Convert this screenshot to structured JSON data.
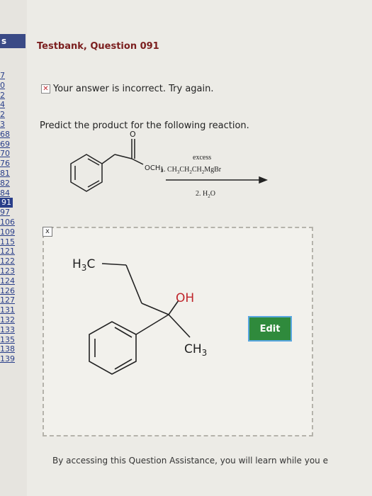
{
  "sidebar": {
    "top_tab": "s",
    "items": [
      "7",
      "0",
      "2",
      "4",
      "2",
      "3",
      "68",
      "69",
      "70",
      "76",
      "81",
      "82",
      "84",
      "91",
      "97",
      "106",
      "109",
      "115",
      "121",
      "122",
      "123",
      "124",
      "126",
      "127",
      "131",
      "132",
      "133",
      "135",
      "138",
      "139"
    ],
    "current": "91"
  },
  "title": "Testbank, Question 091",
  "feedback": {
    "icon": "x-icon",
    "text": "Your answer is incorrect.  Try again."
  },
  "prompt": "Predict the product for the following reaction.",
  "reaction": {
    "carbonyl_o": "O",
    "ester_group": "OCH",
    "ester_sub": "3",
    "reagent_excess": "excess",
    "reagent_1": "1. CH",
    "reagent_1_sub1": "3",
    "reagent_1_mid1": "CH",
    "reagent_1_sub2": "2",
    "reagent_1_mid2": "CH",
    "reagent_1_sub3": "2",
    "reagent_1_end": "MgBr",
    "reagent_2": "2. H",
    "reagent_2_sub": "2",
    "reagent_2_end": "O"
  },
  "answer": {
    "close_symbol": "x",
    "h3c_h": "H",
    "h3c_sub": "3",
    "h3c_c": "C",
    "oh": "OH",
    "ch3_c": "CH",
    "ch3_sub": "3",
    "edit_label": "Edit"
  },
  "footer": "By accessing this Question Assistance, you will learn while you e"
}
